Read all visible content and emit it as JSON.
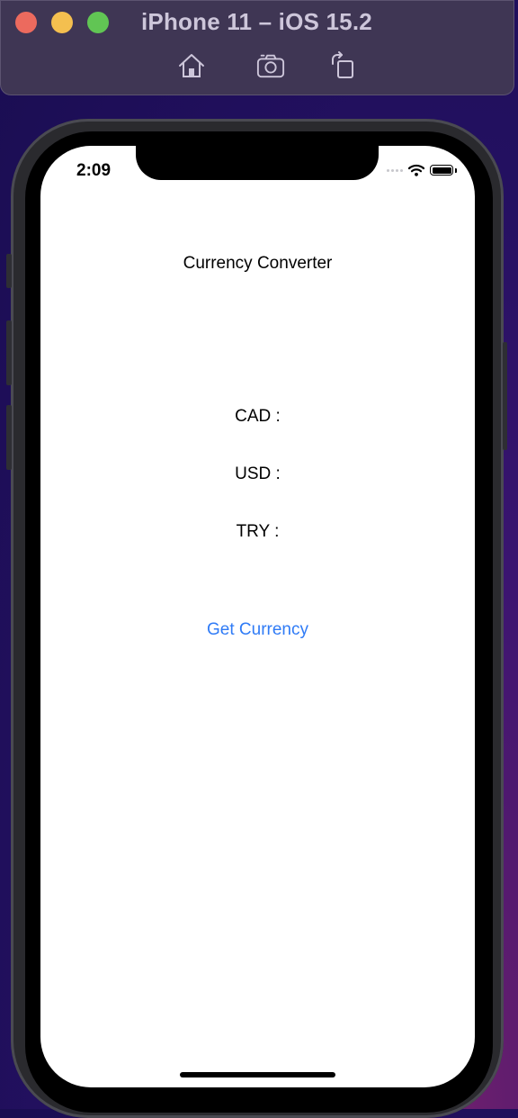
{
  "simulator": {
    "title": "iPhone 11 – iOS 15.2",
    "toolbar_icons": [
      "home-icon",
      "screenshot-icon",
      "rotate-icon"
    ]
  },
  "status_bar": {
    "time": "2:09",
    "icons": [
      "signal-icon",
      "wifi-icon",
      "battery-icon"
    ]
  },
  "app": {
    "title": "Currency Converter",
    "labels": {
      "cad": "CAD :",
      "usd": "USD :",
      "try": "TRY :"
    },
    "button_label": "Get Currency"
  },
  "colors": {
    "accent": "#2f7bf6",
    "close": "#ec6a5e",
    "minimize": "#f4bf4f",
    "zoom": "#61c554",
    "toolbar_bg": "#3f3654"
  }
}
